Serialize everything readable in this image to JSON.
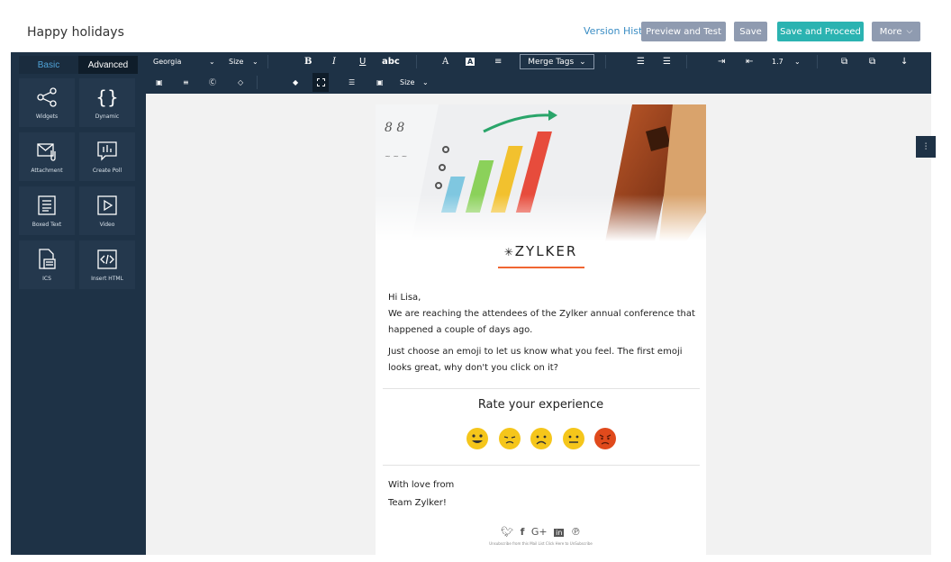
{
  "header": {
    "title": "Happy holidays",
    "version_history": "Version History",
    "preview_test": "Preview and Test",
    "save": "Save",
    "save_proceed": "Save and Proceed",
    "more": "More"
  },
  "sidebar": {
    "tabs": [
      "Basic",
      "Advanced"
    ],
    "tiles": [
      {
        "label": "Widgets",
        "icon": "share-icon"
      },
      {
        "label": "Dynamic",
        "icon": "curly-braces-icon"
      },
      {
        "label": "Attachment",
        "icon": "attachment-icon"
      },
      {
        "label": "Create Poll",
        "icon": "poll-icon"
      },
      {
        "label": "Boxed Text",
        "icon": "boxed-text-icon"
      },
      {
        "label": "Video",
        "icon": "video-icon"
      },
      {
        "label": "ICS",
        "icon": "calendar-file-icon"
      },
      {
        "label": "Insert HTML",
        "icon": "code-icon"
      }
    ]
  },
  "toolbar": {
    "font": "Georgia",
    "size": "Size",
    "bold": "B",
    "italic": "I",
    "underline": "U",
    "strike": "abc",
    "merge_tags": "Merge Tags",
    "line_height": "1.7",
    "size2": "Size"
  },
  "email": {
    "logo": "ZYLKER",
    "greeting": "Hi Lisa,",
    "line1": "We are reaching the attendees of the Zylker annual conference that happened a couple of days ago.",
    "line2": "Just choose an emoji to let us know what you feel. The first emoji looks great, why don't you click on it?",
    "rate_title": "Rate your experience",
    "signoff1": "With love from",
    "signoff2": "Team Zylker!",
    "social": [
      "twitter-icon",
      "facebook-icon",
      "google-plus-icon",
      "linkedin-icon",
      "pinterest-icon"
    ],
    "unsubscribe": "Unsubscribe from this Mail List  Click Here to UnSubscribe"
  },
  "colors": {
    "sidebar_bg": "#1e3246",
    "accent_teal": "#2bb3b1",
    "button_gray": "#8f9bb0",
    "logo_underline": "#f06532"
  }
}
